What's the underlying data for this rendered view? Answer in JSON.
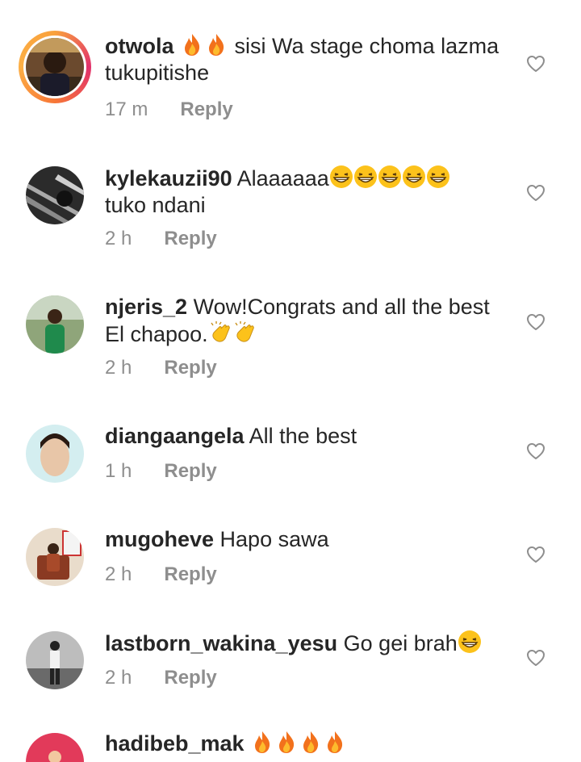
{
  "comments": [
    {
      "username": "otwola",
      "text": "sisi Wa stage choma lazma tukupitishe",
      "leading_emojis": [
        "fire-emoji",
        "fire-emoji"
      ],
      "time": "17 m",
      "reply_label": "Reply",
      "has_story_ring": true
    },
    {
      "username": "kylekauzii90",
      "text_before": "Alaaaaaa",
      "trailing_emojis": [
        "grinning-squint-emoji",
        "grinning-squint-emoji",
        "grinning-squint-emoji",
        "grinning-squint-emoji",
        "grinning-squint-emoji"
      ],
      "text_after": "tuko ndani",
      "time": "2 h",
      "reply_label": "Reply"
    },
    {
      "username": "njeris_2",
      "text": "Wow!Congrats and all the best El chapoo.",
      "trailing_emojis": [
        "clapping-hands-emoji",
        "clapping-hands-emoji"
      ],
      "time": "2 h",
      "reply_label": "Reply"
    },
    {
      "username": "diangaangela",
      "text": "All the best",
      "time": "1 h",
      "reply_label": "Reply"
    },
    {
      "username": "mugoheve",
      "text": "Hapo sawa",
      "time": "2 h",
      "reply_label": "Reply"
    },
    {
      "username": "lastborn_wakina_yesu",
      "text": "Go gei brah",
      "trailing_emojis": [
        "grinning-squint-emoji"
      ],
      "time": "2 h",
      "reply_label": "Reply"
    },
    {
      "username": "hadibeb_mak",
      "trailing_emojis": [
        "fire-emoji",
        "fire-emoji",
        "fire-emoji",
        "fire-emoji"
      ]
    }
  ],
  "icons": {
    "like": "heart-outline-icon"
  },
  "colors": {
    "username": "#262626",
    "meta": "#8e8e8e",
    "heart_stroke": "#8e8e8e"
  }
}
